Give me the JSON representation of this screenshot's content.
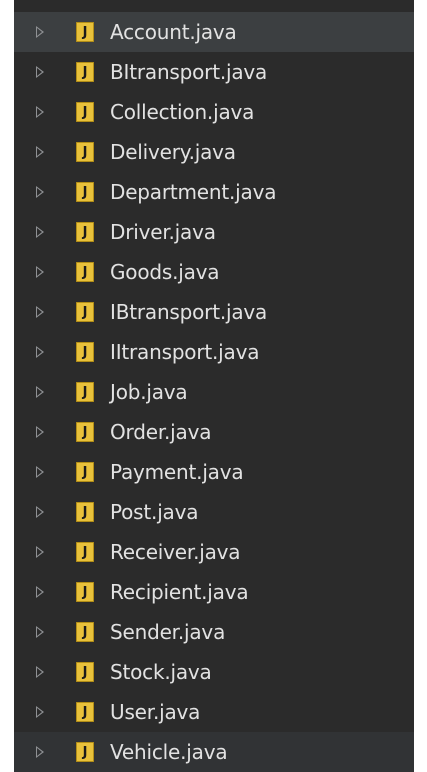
{
  "file_tree": {
    "items": [
      {
        "label": "Account.java",
        "icon": "java-file-icon",
        "icon_glyph": "J",
        "selected": true
      },
      {
        "label": "BItransport.java",
        "icon": "java-file-icon",
        "icon_glyph": "J"
      },
      {
        "label": "Collection.java",
        "icon": "java-file-icon",
        "icon_glyph": "J"
      },
      {
        "label": "Delivery.java",
        "icon": "java-file-icon",
        "icon_glyph": "J"
      },
      {
        "label": "Department.java",
        "icon": "java-file-icon",
        "icon_glyph": "J"
      },
      {
        "label": "Driver.java",
        "icon": "java-file-icon",
        "icon_glyph": "J"
      },
      {
        "label": "Goods.java",
        "icon": "java-file-icon",
        "icon_glyph": "J"
      },
      {
        "label": "IBtransport.java",
        "icon": "java-file-icon",
        "icon_glyph": "J"
      },
      {
        "label": "IItransport.java",
        "icon": "java-file-icon",
        "icon_glyph": "J"
      },
      {
        "label": "Job.java",
        "icon": "java-file-icon",
        "icon_glyph": "J"
      },
      {
        "label": "Order.java",
        "icon": "java-file-icon",
        "icon_glyph": "J"
      },
      {
        "label": "Payment.java",
        "icon": "java-file-icon",
        "icon_glyph": "J"
      },
      {
        "label": "Post.java",
        "icon": "java-file-icon",
        "icon_glyph": "J"
      },
      {
        "label": "Receiver.java",
        "icon": "java-file-icon",
        "icon_glyph": "J"
      },
      {
        "label": "Recipient.java",
        "icon": "java-file-icon",
        "icon_glyph": "J"
      },
      {
        "label": "Sender.java",
        "icon": "java-file-icon",
        "icon_glyph": "J"
      },
      {
        "label": "Stock.java",
        "icon": "java-file-icon",
        "icon_glyph": "J"
      },
      {
        "label": "User.java",
        "icon": "java-file-icon",
        "icon_glyph": "J"
      },
      {
        "label": "Vehicle.java",
        "icon": "java-file-icon",
        "icon_glyph": "J"
      }
    ]
  },
  "colors": {
    "background": "#2b2b2b",
    "selected_row": "#3c3f41",
    "text": "#e2e2e2",
    "icon_fill": "#e8c13b",
    "arrow": "#8f9194"
  }
}
